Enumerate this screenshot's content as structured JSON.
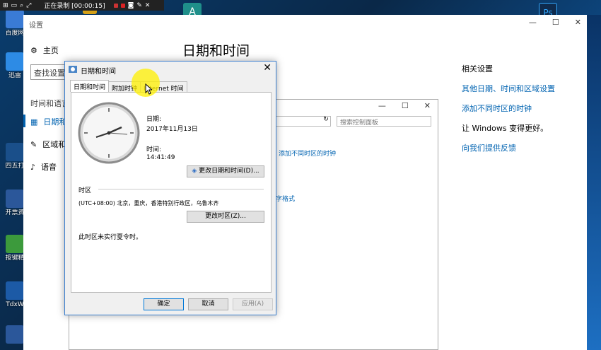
{
  "recorder": {
    "status": "正在录制 [00:00:15]"
  },
  "desktop": {
    "icons": [
      {
        "label": "百度网",
        "color": "#3a7bd5"
      },
      {
        "label": "迅雷",
        "color": "#2d8be5"
      },
      {
        "label": "四五打",
        "color": "#1a4f8a"
      },
      {
        "label": "开票资",
        "color": "#2b579a"
      },
      {
        "label": "按键精",
        "color": "#3c9a3c"
      },
      {
        "label": "TdxW",
        "color": "#1c5aa6"
      },
      {
        "label": "",
        "color": "#2b579a"
      }
    ],
    "top_icons": [
      {
        "label": "A",
        "color": "#1f8f8a"
      },
      {
        "label": "Ps",
        "color": "#0f2b4d"
      }
    ]
  },
  "settings": {
    "title": "设置",
    "home": "主页",
    "search_placeholder": "查找设置",
    "section": "时间和语言",
    "nav": [
      {
        "label": "日期和",
        "icon": "calendar-icon",
        "active": true
      },
      {
        "label": "区域和",
        "icon": "globe-icon",
        "active": false
      },
      {
        "label": "语音",
        "icon": "microphone-icon",
        "active": false
      }
    ],
    "heading": "日期和时间",
    "related_title": "相关设置",
    "related_links": [
      "其他日期、时间和区域设置",
      "添加不同时区的时钟"
    ],
    "feedback_title": "让 Windows 变得更好。",
    "feedback_link": "向我们提供反馈"
  },
  "control_panel": {
    "search_placeholder": "搜索控制面板",
    "links": [
      "添加不同时区的时钟",
      "字格式"
    ]
  },
  "dialog": {
    "title": "日期和时间",
    "tabs": [
      "日期和时间",
      "附加时钟",
      "Internet 时间"
    ],
    "date_label": "日期:",
    "date_value": "2017年11月13日",
    "time_label": "时间:",
    "time_value": "14:41:49",
    "change_datetime_button": "更改日期和时间(D)...",
    "timezone_section": "时区",
    "timezone_value": "(UTC+08:00) 北京，重庆，香港特别行政区，乌鲁木齐",
    "change_timezone_button": "更改时区(Z)...",
    "dst_note": "此时区未实行夏令时。",
    "ok_button": "确定",
    "cancel_button": "取消",
    "apply_button": "应用(A)"
  }
}
